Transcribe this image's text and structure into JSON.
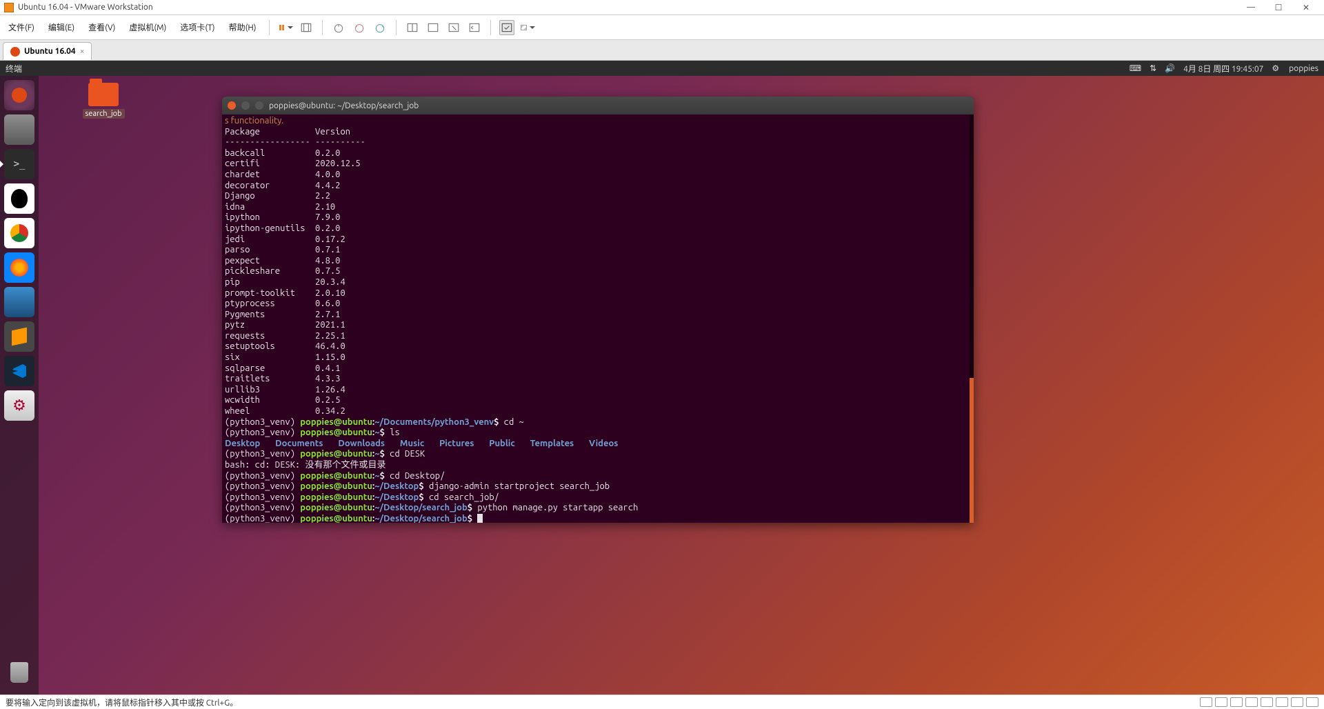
{
  "vmware": {
    "title": "Ubuntu 16.04 - VMware Workstation",
    "menus": [
      "文件(F)",
      "编辑(E)",
      "查看(V)",
      "虚拟机(M)",
      "选项卡(T)",
      "帮助(H)"
    ],
    "tab_label": "Ubuntu 16.04",
    "footer_hint": "要将输入定向到该虚拟机，请将鼠标指针移入其中或按 Ctrl+G。"
  },
  "ubuntu_topbar": {
    "app_title": "终端",
    "date_time": "4月 8日 周四 19:45:07",
    "user": "poppies"
  },
  "desktop_folder": {
    "label": "search_job"
  },
  "terminal": {
    "title": "poppies@ubuntu: ~/Desktop/search_job",
    "header_partial": "s functionality.",
    "pkg_header_left": "Package",
    "pkg_header_right": "Version",
    "pkg_divider": "----------------- ----------",
    "packages": [
      [
        "backcall",
        "0.2.0"
      ],
      [
        "certifi",
        "2020.12.5"
      ],
      [
        "chardet",
        "4.0.0"
      ],
      [
        "decorator",
        "4.4.2"
      ],
      [
        "Django",
        "2.2"
      ],
      [
        "idna",
        "2.10"
      ],
      [
        "ipython",
        "7.9.0"
      ],
      [
        "ipython-genutils",
        "0.2.0"
      ],
      [
        "jedi",
        "0.17.2"
      ],
      [
        "parso",
        "0.7.1"
      ],
      [
        "pexpect",
        "4.8.0"
      ],
      [
        "pickleshare",
        "0.7.5"
      ],
      [
        "pip",
        "20.3.4"
      ],
      [
        "prompt-toolkit",
        "2.0.10"
      ],
      [
        "ptyprocess",
        "0.6.0"
      ],
      [
        "Pygments",
        "2.7.1"
      ],
      [
        "pytz",
        "2021.1"
      ],
      [
        "requests",
        "2.25.1"
      ],
      [
        "setuptools",
        "46.4.0"
      ],
      [
        "six",
        "1.15.0"
      ],
      [
        "sqlparse",
        "0.4.1"
      ],
      [
        "traitlets",
        "4.3.3"
      ],
      [
        "urllib3",
        "1.26.4"
      ],
      [
        "wcwidth",
        "0.2.5"
      ],
      [
        "wheel",
        "0.34.2"
      ]
    ],
    "venv": "(python3_venv) ",
    "user_host": "poppies@ubuntu",
    "paths": {
      "docs": "~/Documents/python3_venv",
      "home": "~",
      "desk": "~/Desktop",
      "proj": "~/Desktop/search_job"
    },
    "cmds": {
      "cd_home": "cd ~",
      "ls": "ls",
      "cd_desk_bad": "cd DESK",
      "bash_err": "bash: cd: DESK: 没有那个文件或目录",
      "cd_desktop": "cd Desktop/",
      "startproj": "django-admin startproject search_job",
      "cd_proj": "cd search_job/",
      "startapp": "python manage.py startapp search"
    },
    "ls_dirs": [
      "Desktop",
      "Documents",
      "Downloads",
      "Music",
      "Pictures",
      "Public",
      "Templates",
      "Videos"
    ]
  }
}
